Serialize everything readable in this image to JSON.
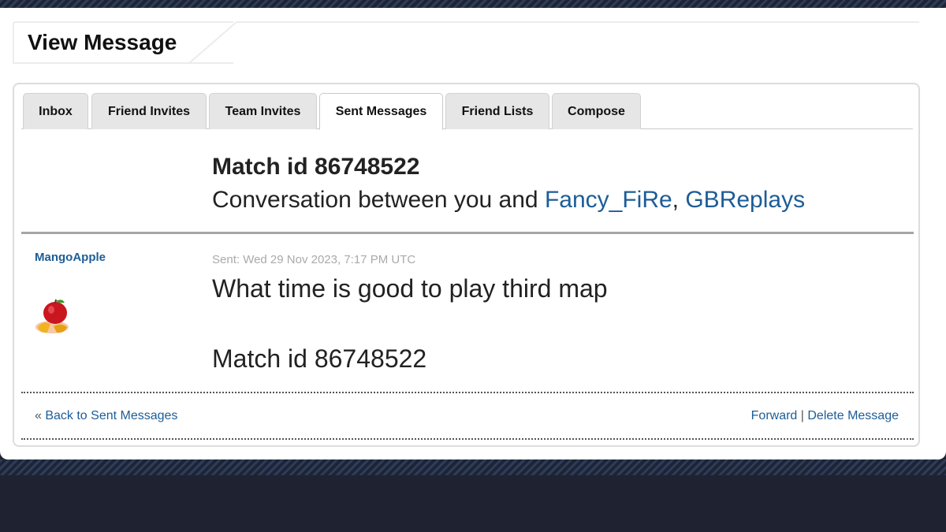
{
  "page": {
    "title": "View Message"
  },
  "tabs": [
    {
      "label": "Inbox"
    },
    {
      "label": "Friend Invites"
    },
    {
      "label": "Team Invites"
    },
    {
      "label": "Sent Messages"
    },
    {
      "label": "Friend Lists"
    },
    {
      "label": "Compose"
    }
  ],
  "active_tab": "Sent Messages",
  "message": {
    "subject": "Match id 86748522",
    "conversation_prefix": "Conversation between you and ",
    "participants": [
      "Fancy_FiRe",
      "GBReplays"
    ],
    "separator": ", ",
    "author": "MangoApple",
    "avatar_icon": "apple-mango-icon",
    "sent": "Sent: Wed 29 Nov 2023, 7:17 PM UTC",
    "body_line1": "What time is good to play third map",
    "body_line2": "Match id 86748522"
  },
  "footer": {
    "back_prefix": "« ",
    "back_label": "Back to Sent Messages",
    "forward_label": "Forward",
    "action_separator": " | ",
    "delete_label": "Delete Message"
  },
  "colors": {
    "link": "#1c5d97",
    "background_dark": "#1f2230",
    "stripe": "#2d3d5a",
    "muted_text": "#aaaaaa"
  }
}
